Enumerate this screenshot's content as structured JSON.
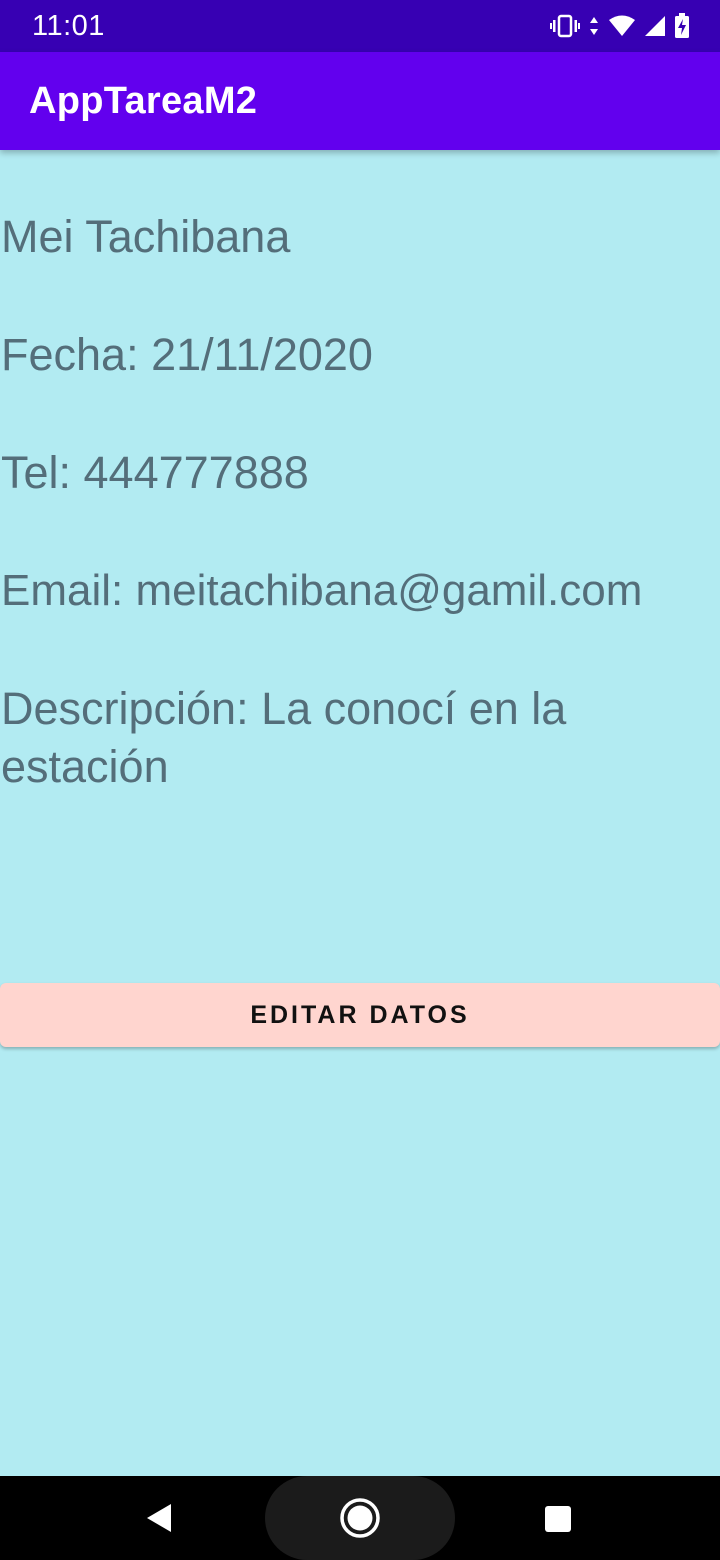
{
  "status_bar": {
    "time": "11:01",
    "icons": [
      "vibrate-icon",
      "data-arrows-icon",
      "wifi-icon",
      "signal-icon",
      "battery-charging-icon"
    ]
  },
  "app_bar": {
    "title": "AppTareaM2"
  },
  "contact": {
    "name": "Mei Tachibana",
    "date": "Fecha: 21/11/2020",
    "phone": "Tel: 444777888",
    "email": "Email: meitachibana@gamil.com",
    "description": "Descripción: La conocí en la estación"
  },
  "actions": {
    "edit_label": "EDITAR DATOS"
  },
  "navigation": {
    "icons": [
      "back-icon",
      "home-icon",
      "recents-icon"
    ]
  },
  "colors": {
    "status_bar": "#3700b3",
    "app_bar": "#6200ee",
    "background": "#b2ebf2",
    "text": "#546e7a",
    "button": "#ffd5cf"
  }
}
